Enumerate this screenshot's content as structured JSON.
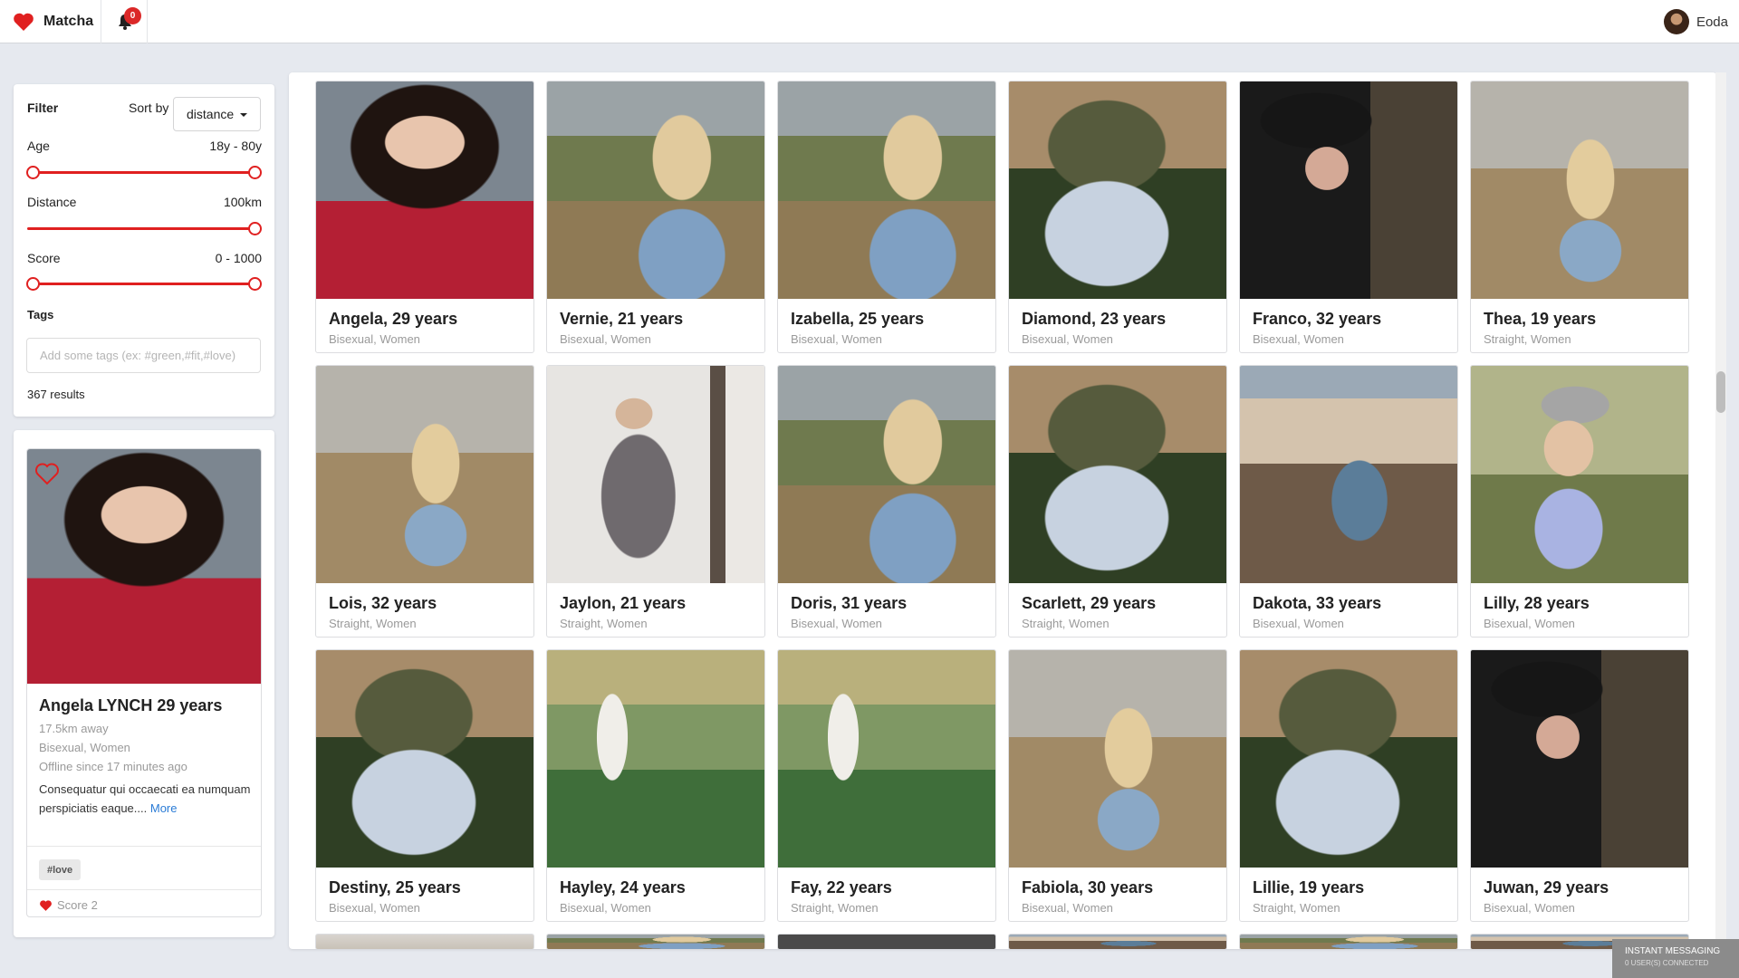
{
  "header": {
    "brand": "Matcha",
    "notification_count": "0",
    "username": "Eoda"
  },
  "filter": {
    "title": "Filter",
    "sort_label": "Sort by",
    "sort_value": "distance",
    "age_label": "Age",
    "age_value": "18y - 80y",
    "distance_label": "Distance",
    "distance_value": "100km",
    "score_label": "Score",
    "score_value": "0 - 1000",
    "tags_label": "Tags",
    "tags_placeholder": "Add some tags (ex: #green,#fit,#love)",
    "results": "367 results"
  },
  "detail": {
    "name": "Angela LYNCH 29 years",
    "distance": "17.5km away",
    "orientation": "Bisexual, Women",
    "status": "Offline since 17 minutes ago",
    "bio": "Consequatur qui occaecati ea numquam perspiciatis eaque....",
    "more": "More",
    "tag": "#love",
    "score": "Score 2"
  },
  "profiles": [
    {
      "name": "Angela, 29 years",
      "sub": "Bisexual, Women"
    },
    {
      "name": "Vernie, 21 years",
      "sub": "Bisexual, Women"
    },
    {
      "name": "Izabella, 25 years",
      "sub": "Bisexual, Women"
    },
    {
      "name": "Diamond, 23 years",
      "sub": "Bisexual, Women"
    },
    {
      "name": "Franco, 32 years",
      "sub": "Bisexual, Women"
    },
    {
      "name": "Thea, 19 years",
      "sub": "Straight, Women"
    },
    {
      "name": "Lois, 32 years",
      "sub": "Straight, Women"
    },
    {
      "name": "Jaylon, 21 years",
      "sub": "Straight, Women"
    },
    {
      "name": "Doris, 31 years",
      "sub": "Bisexual, Women"
    },
    {
      "name": "Scarlett, 29 years",
      "sub": "Straight, Women"
    },
    {
      "name": "Dakota, 33 years",
      "sub": "Bisexual, Women"
    },
    {
      "name": "Lilly, 28 years",
      "sub": "Bisexual, Women"
    },
    {
      "name": "Destiny, 25 years",
      "sub": "Bisexual, Women"
    },
    {
      "name": "Hayley, 24 years",
      "sub": "Bisexual, Women"
    },
    {
      "name": "Fay, 22 years",
      "sub": "Straight, Women"
    },
    {
      "name": "Fabiola, 30 years",
      "sub": "Bisexual, Women"
    },
    {
      "name": "Lillie, 19 years",
      "sub": "Straight, Women"
    },
    {
      "name": "Juwan, 29 years",
      "sub": "Bisexual, Women"
    }
  ],
  "chat": {
    "title": "INSTANT MESSAGING",
    "status": "0 USER(S) CONNECTED"
  },
  "colors": {
    "accent": "#e02020",
    "link": "#2a7bd6",
    "badge": "#db2828"
  }
}
